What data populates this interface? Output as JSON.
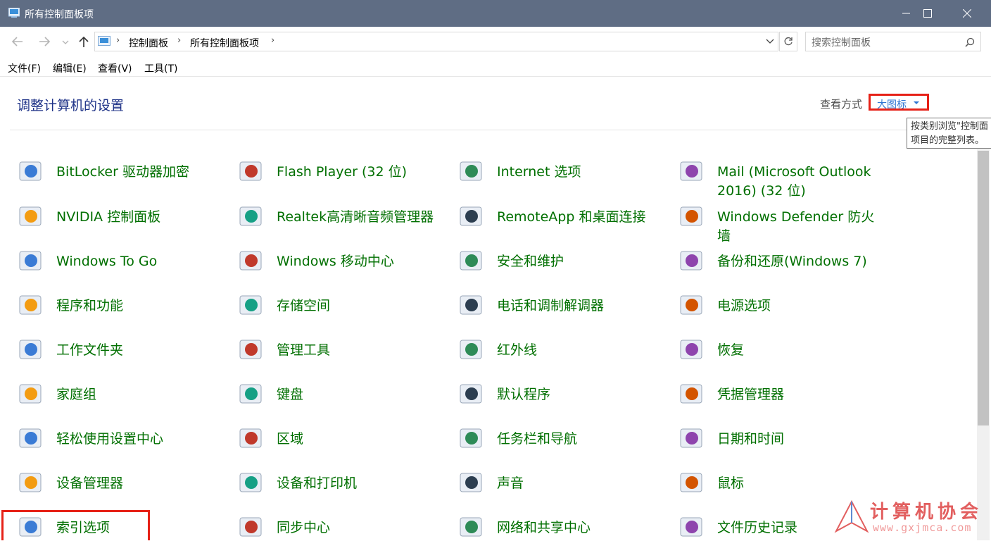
{
  "window": {
    "title": "所有控制面板项"
  },
  "nav": {
    "breadcrumbs": [
      "控制面板",
      "所有控制面板项"
    ],
    "search_placeholder": "搜索控制面板"
  },
  "menu": [
    "文件(F)",
    "编辑(E)",
    "查看(V)",
    "工具(T)"
  ],
  "header": {
    "title": "调整计算机的设置",
    "viewby_label": "查看方式",
    "viewby_value": "大图标"
  },
  "tooltip": {
    "line1": "按类别浏览\"控制面",
    "line2": "项目的完整列表。"
  },
  "items": [
    {
      "label": "BitLocker 驱动器加密",
      "icon": "bitlocker-icon"
    },
    {
      "label": "Flash Player (32 位)",
      "icon": "flash-player-icon"
    },
    {
      "label": "Internet 选项",
      "icon": "internet-options-icon"
    },
    {
      "label": "Mail (Microsoft Outlook 2016) (32 位)",
      "icon": "mail-icon"
    },
    {
      "label": "NVIDIA 控制面板",
      "icon": "nvidia-icon"
    },
    {
      "label": "Realtek高清晰音频管理器",
      "icon": "realtek-audio-icon"
    },
    {
      "label": "RemoteApp 和桌面连接",
      "icon": "remoteapp-icon"
    },
    {
      "label": "Windows Defender 防火墙",
      "icon": "firewall-icon"
    },
    {
      "label": "Windows To Go",
      "icon": "windows-to-go-icon"
    },
    {
      "label": "Windows 移动中心",
      "icon": "mobility-center-icon"
    },
    {
      "label": "安全和维护",
      "icon": "security-flag-icon"
    },
    {
      "label": "备份和还原(Windows 7)",
      "icon": "backup-restore-icon"
    },
    {
      "label": "程序和功能",
      "icon": "programs-icon"
    },
    {
      "label": "存储空间",
      "icon": "storage-spaces-icon"
    },
    {
      "label": "电话和调制解调器",
      "icon": "phone-modem-icon"
    },
    {
      "label": "电源选项",
      "icon": "power-options-icon"
    },
    {
      "label": "工作文件夹",
      "icon": "work-folders-icon"
    },
    {
      "label": "管理工具",
      "icon": "admin-tools-icon"
    },
    {
      "label": "红外线",
      "icon": "infrared-icon"
    },
    {
      "label": "恢复",
      "icon": "recovery-icon"
    },
    {
      "label": "家庭组",
      "icon": "homegroup-icon"
    },
    {
      "label": "键盘",
      "icon": "keyboard-icon"
    },
    {
      "label": "默认程序",
      "icon": "default-programs-icon"
    },
    {
      "label": "凭据管理器",
      "icon": "credential-manager-icon"
    },
    {
      "label": "轻松使用设置中心",
      "icon": "ease-of-access-icon"
    },
    {
      "label": "区域",
      "icon": "region-icon"
    },
    {
      "label": "任务栏和导航",
      "icon": "taskbar-icon"
    },
    {
      "label": "日期和时间",
      "icon": "date-time-icon"
    },
    {
      "label": "设备管理器",
      "icon": "device-manager-icon"
    },
    {
      "label": "设备和打印机",
      "icon": "devices-printers-icon"
    },
    {
      "label": "声音",
      "icon": "sound-icon"
    },
    {
      "label": "鼠标",
      "icon": "mouse-icon"
    },
    {
      "label": "索引选项",
      "icon": "indexing-options-icon"
    },
    {
      "label": "同步中心",
      "icon": "sync-center-icon"
    },
    {
      "label": "网络和共享中心",
      "icon": "network-sharing-icon"
    },
    {
      "label": "文件历史记录",
      "icon": "file-history-icon"
    }
  ],
  "watermark": {
    "title": "计算机协会",
    "url": "www.gxjmca.com"
  }
}
